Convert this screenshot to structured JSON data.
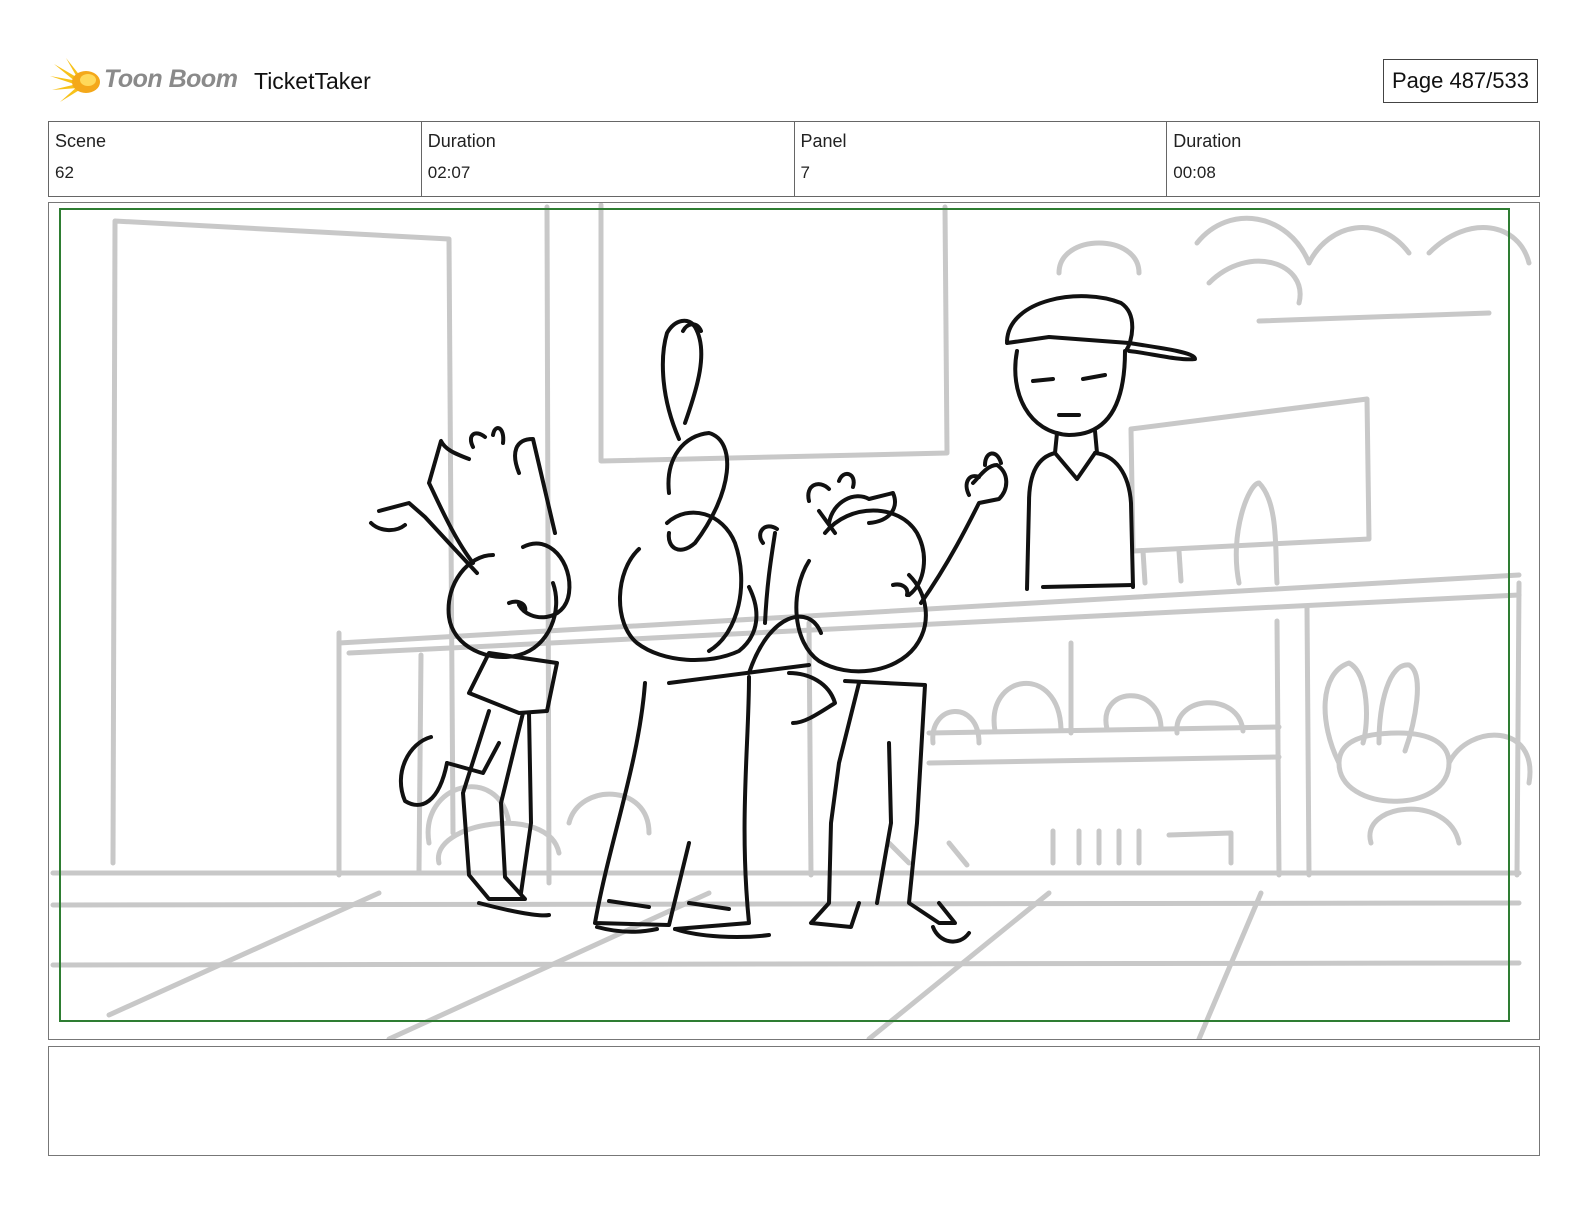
{
  "header": {
    "logo_text": "Toon Boom",
    "project_title": "TicketTaker",
    "page_label": "Page 487/533"
  },
  "info": {
    "scene_label": "Scene",
    "scene_value": "62",
    "scene_duration_label": "Duration",
    "scene_duration_value": "02:07",
    "panel_label": "Panel",
    "panel_value": "7",
    "panel_duration_label": "Duration",
    "panel_duration_value": "00:08"
  },
  "colors": {
    "safe_frame": "#2e7d32",
    "logo_accent": "#f7c21a",
    "sketch_line": "#111111",
    "background_line": "#c8c8c8"
  },
  "notes": {
    "text": ""
  }
}
